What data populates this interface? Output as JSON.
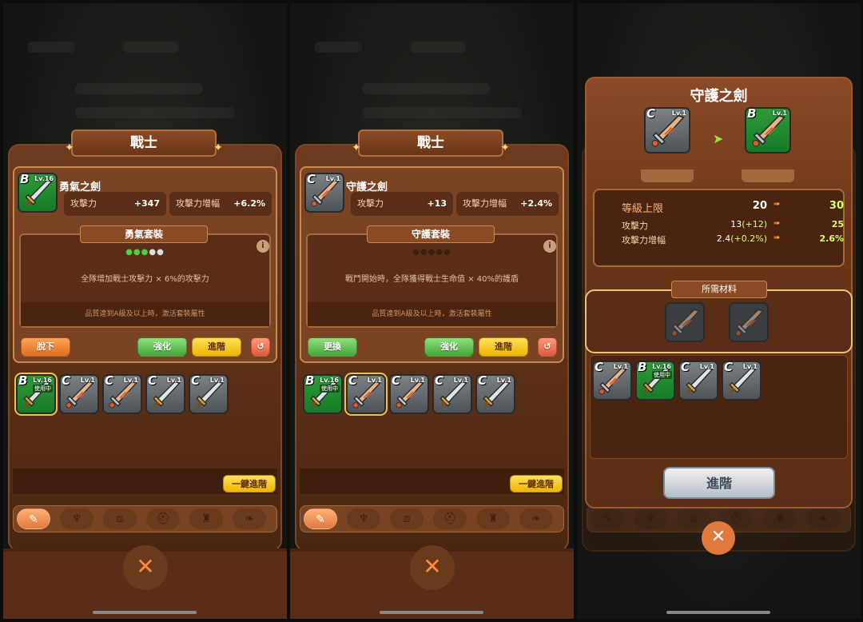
{
  "colors": {
    "brown": "#5a2e16",
    "accent": "#e0793e",
    "green": "#43a83a",
    "yellow": "#f0b400"
  },
  "s1": {
    "title": "戰士",
    "weapon": {
      "grade": "B",
      "level": "Lv.16",
      "name": "勇氣之劍"
    },
    "stats": [
      {
        "label": "攻擊力",
        "value": "+347"
      },
      {
        "label": "攻擊力增幅",
        "value": "+6.2%"
      }
    ],
    "set": {
      "title": "勇氣套裝",
      "desc": "全隊增加戰士攻擊力 × 6%的攻擊力",
      "note": "品質達到A級及以上時，激活套裝屬性"
    },
    "buttons": {
      "unequip": "脫下",
      "enhance": "強化",
      "promote": "進階"
    },
    "inventory": [
      {
        "grade": "B",
        "level": "Lv.16",
        "tag": "使用中"
      },
      {
        "grade": "C",
        "level": "Lv.1"
      },
      {
        "grade": "C",
        "level": "Lv.1"
      },
      {
        "grade": "C",
        "level": "Lv.1"
      },
      {
        "grade": "C",
        "level": "Lv.1"
      }
    ],
    "onekey": "一鍵進階",
    "close": "✕"
  },
  "s2": {
    "title": "戰士",
    "weapon": {
      "grade": "C",
      "level": "Lv.1",
      "name": "守護之劍"
    },
    "stats": [
      {
        "label": "攻擊力",
        "value": "+13"
      },
      {
        "label": "攻擊力增幅",
        "value": "+2.4%"
      }
    ],
    "set": {
      "title": "守護套裝",
      "desc": "戰鬥開始時，全隊獲得戰士生命值 × 40%的護盾",
      "note": "品質達到A級及以上時，激活套裝屬性"
    },
    "buttons": {
      "swap": "更換",
      "enhance": "強化",
      "promote": "進階"
    },
    "inventory": [
      {
        "grade": "B",
        "level": "Lv.16",
        "tag": "使用中"
      },
      {
        "grade": "C",
        "level": "Lv.1"
      },
      {
        "grade": "C",
        "level": "Lv.1"
      },
      {
        "grade": "C",
        "level": "Lv.1"
      },
      {
        "grade": "C",
        "level": "Lv.1"
      }
    ],
    "onekey": "一鍵進階",
    "close": "✕"
  },
  "s3": {
    "title": "守護之劍",
    "from": {
      "grade": "C",
      "level": "Lv.1"
    },
    "to": {
      "grade": "B",
      "level": "Lv.1"
    },
    "rows": [
      {
        "label": "等級上限",
        "from": "20",
        "to": "30"
      },
      {
        "label": "攻擊力",
        "from": "13",
        "delta": "(+12)",
        "to": "25"
      },
      {
        "label": "攻擊力增幅",
        "from": "2.4",
        "delta": "(+0.2%)",
        "to": "2.6%"
      }
    ],
    "materials_title": "所需材料",
    "inventory": [
      {
        "grade": "C",
        "level": "Lv.1"
      },
      {
        "grade": "B",
        "level": "Lv.16",
        "tag": "使用中"
      },
      {
        "grade": "C",
        "level": "Lv.1"
      },
      {
        "grade": "C",
        "level": "Lv.1"
      }
    ],
    "promote": "進階",
    "close": "✕"
  },
  "tab_icons": [
    "sword-icon",
    "amulet-icon",
    "belt-icon",
    "helmet-icon",
    "armor-icon",
    "boots-icon"
  ]
}
